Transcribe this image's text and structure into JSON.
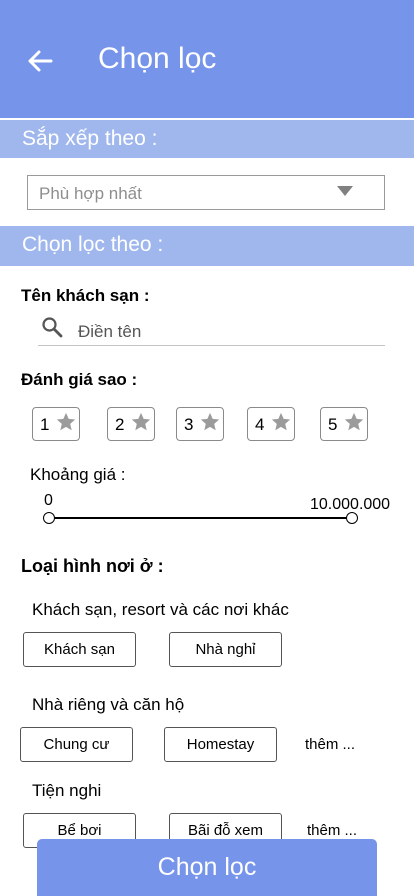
{
  "header": {
    "title": "Chọn lọc",
    "back_icon": "arrow-left-icon"
  },
  "sort": {
    "heading": "Sắp xếp theo :",
    "selected": "Phù hợp nhất"
  },
  "filter": {
    "heading": "Chọn lọc theo :",
    "hotel_name_label": "Tên khách sạn :",
    "hotel_name_placeholder": "Điền tên",
    "stars_label": "Đánh giá sao :",
    "stars": [
      "1",
      "2",
      "3",
      "4",
      "5"
    ],
    "price_label": "Khoảng giá :",
    "price_min": "0",
    "price_max": "10.000.000",
    "accommodation_label": "Loại hình nơi ở :",
    "group1": {
      "title": "Khách sạn, resort và các nơi khác",
      "options": [
        "Khách sạn",
        "Nhà nghỉ"
      ]
    },
    "group2": {
      "title": "Nhà riêng và căn hộ",
      "options": [
        "Chung cư",
        "Homestay"
      ],
      "more": "thêm ..."
    },
    "group3": {
      "title": "Tiện nghi",
      "options": [
        "Bể bơi",
        "Bãi đỗ xem"
      ],
      "more": "thêm ..."
    }
  },
  "apply_button": "Chọn lọc",
  "colors": {
    "primary": "#7694e9",
    "section": "#a0b7ee"
  }
}
